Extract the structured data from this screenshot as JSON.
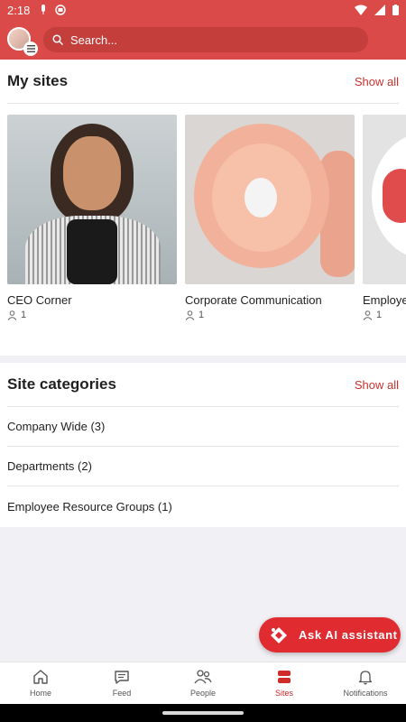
{
  "status_bar": {
    "time": "2:18"
  },
  "search": {
    "placeholder": "Search..."
  },
  "my_sites": {
    "title": "My sites",
    "show_all": "Show all",
    "sites": [
      {
        "name": "CEO Corner",
        "members": "1"
      },
      {
        "name": "Corporate Communication",
        "members": "1"
      },
      {
        "name": "Employe",
        "members": "1"
      }
    ]
  },
  "site_categories": {
    "title": "Site categories",
    "show_all": "Show all",
    "items": [
      {
        "label": "Company Wide (3)"
      },
      {
        "label": "Departments (2)"
      },
      {
        "label": "Employee Resource Groups (1)"
      }
    ]
  },
  "ai_button": {
    "label": "Ask AI assistant"
  },
  "bottom_nav": {
    "items": [
      {
        "label": "Home",
        "icon": "home-icon"
      },
      {
        "label": "Feed",
        "icon": "feed-icon"
      },
      {
        "label": "People",
        "icon": "people-icon"
      },
      {
        "label": "Sites",
        "icon": "sites-icon"
      },
      {
        "label": "Notifications",
        "icon": "bell-icon"
      }
    ],
    "active": "Sites"
  },
  "colors": {
    "brand": "#d94a48",
    "accent": "#e02b31",
    "link": "#c8322e"
  }
}
